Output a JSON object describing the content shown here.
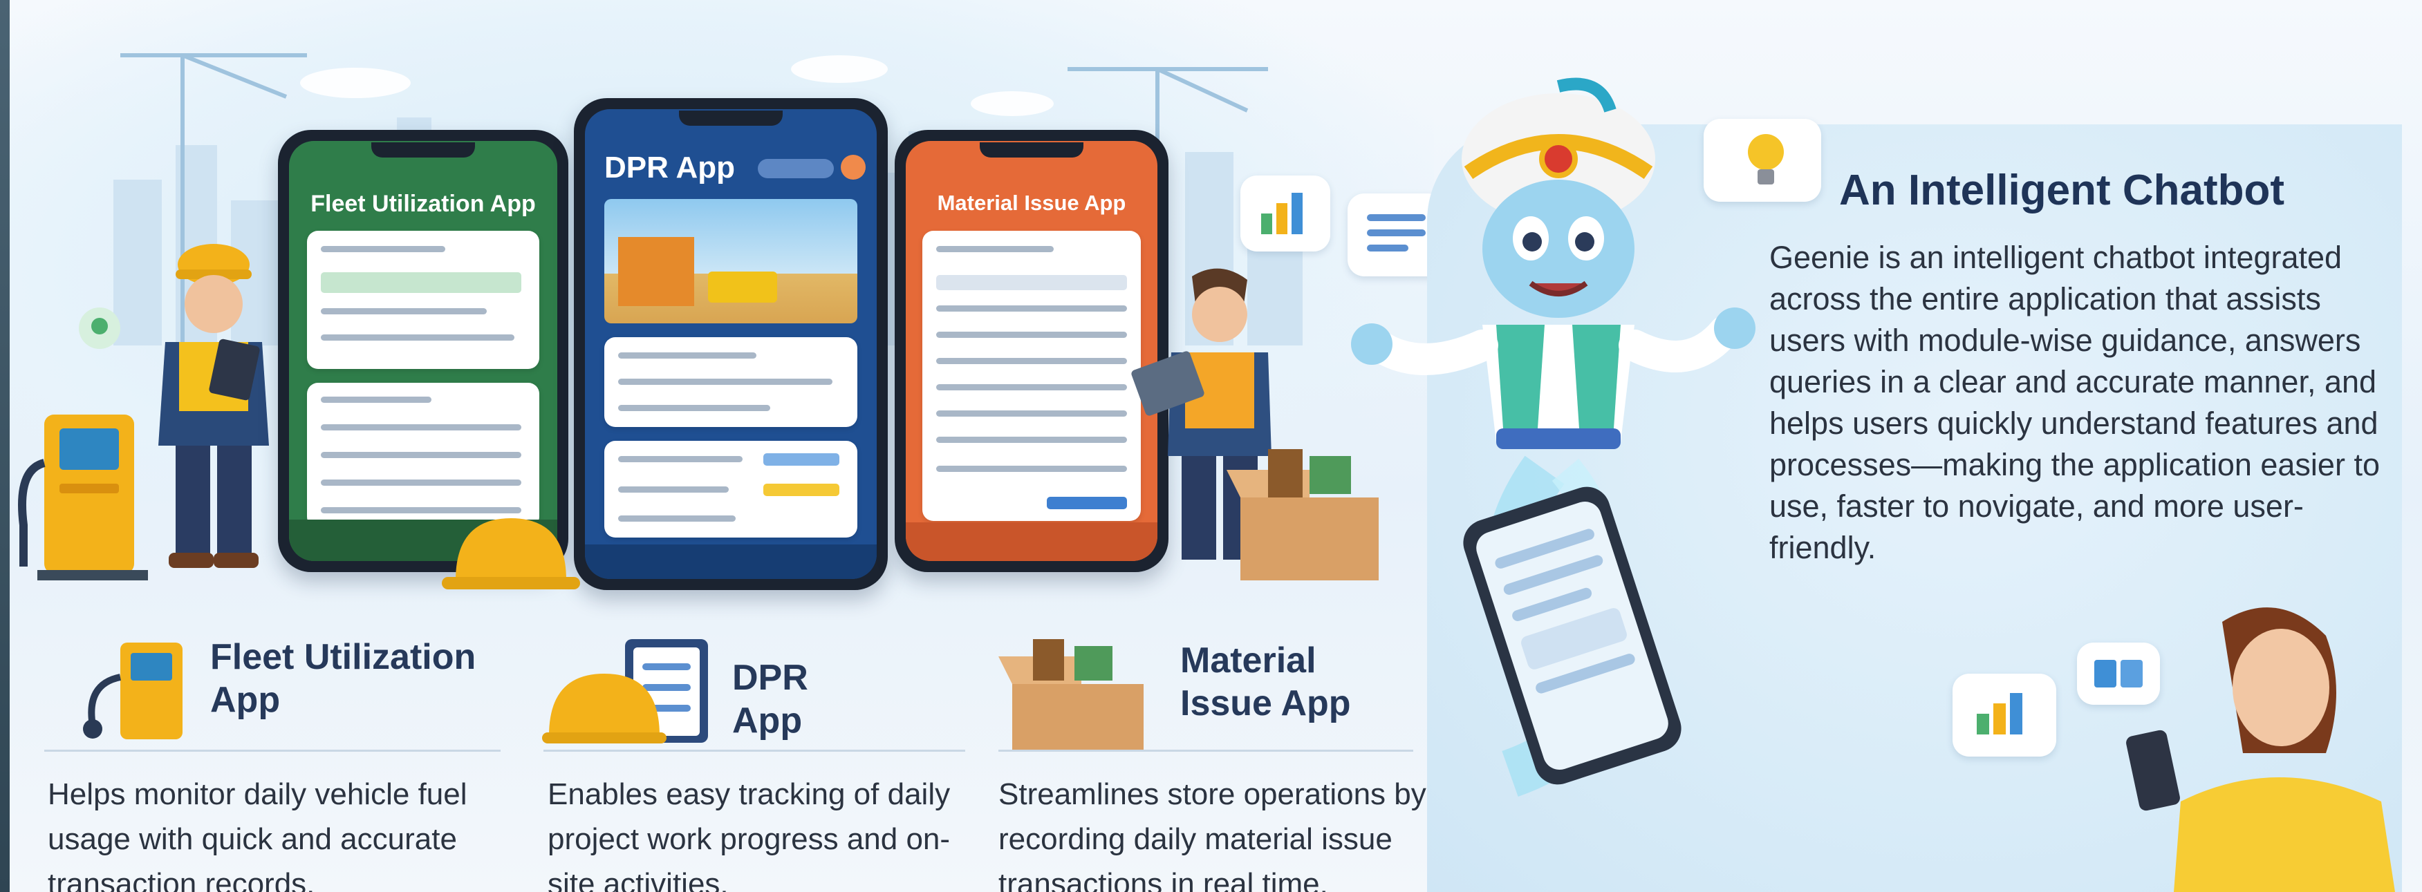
{
  "phones": {
    "fleet": {
      "title": "Fleet Utilization App",
      "color": "#2f7d4a"
    },
    "dpr": {
      "title": "DPR App",
      "color": "#1f4f92"
    },
    "material": {
      "title": "Material Issue App",
      "color": "#e56a38"
    }
  },
  "sections": [
    {
      "title": "Fleet Utilization App",
      "description": "Helps monitor daily vehicle fuel usage with quick and accurate transaction records."
    },
    {
      "title": "DPR App",
      "description": "Enables easy tracking of daily project work progress and on-site activities."
    },
    {
      "title": "Material Issue App",
      "description": "Streamlines store operations by recording daily material issue transactions in real time."
    }
  ],
  "chatbot": {
    "title": "An Intelligent Chatbot",
    "description": "Geenie is an intelligent chatbot integrated across the entire application that assists users with module-wise guidance, answers queries in a clear and accurate manner, and helps users quickly understand features and processes—making the application easier to use, faster to novigate, and more user-friendly."
  },
  "colors": {
    "accent": "#1f3458",
    "fleet_green": "#2f7d4a",
    "dpr_blue": "#1f4f92",
    "material_orange": "#e56a38",
    "helmet_yellow": "#f3b21a"
  },
  "icons": [
    "fuel-pump-icon",
    "helmet-clipboard-icon",
    "material-box-icon",
    "lightbulb-icon",
    "bar-chart-icon",
    "chat-bubble-icon",
    "genie-mascot",
    "smartphone-icon"
  ]
}
